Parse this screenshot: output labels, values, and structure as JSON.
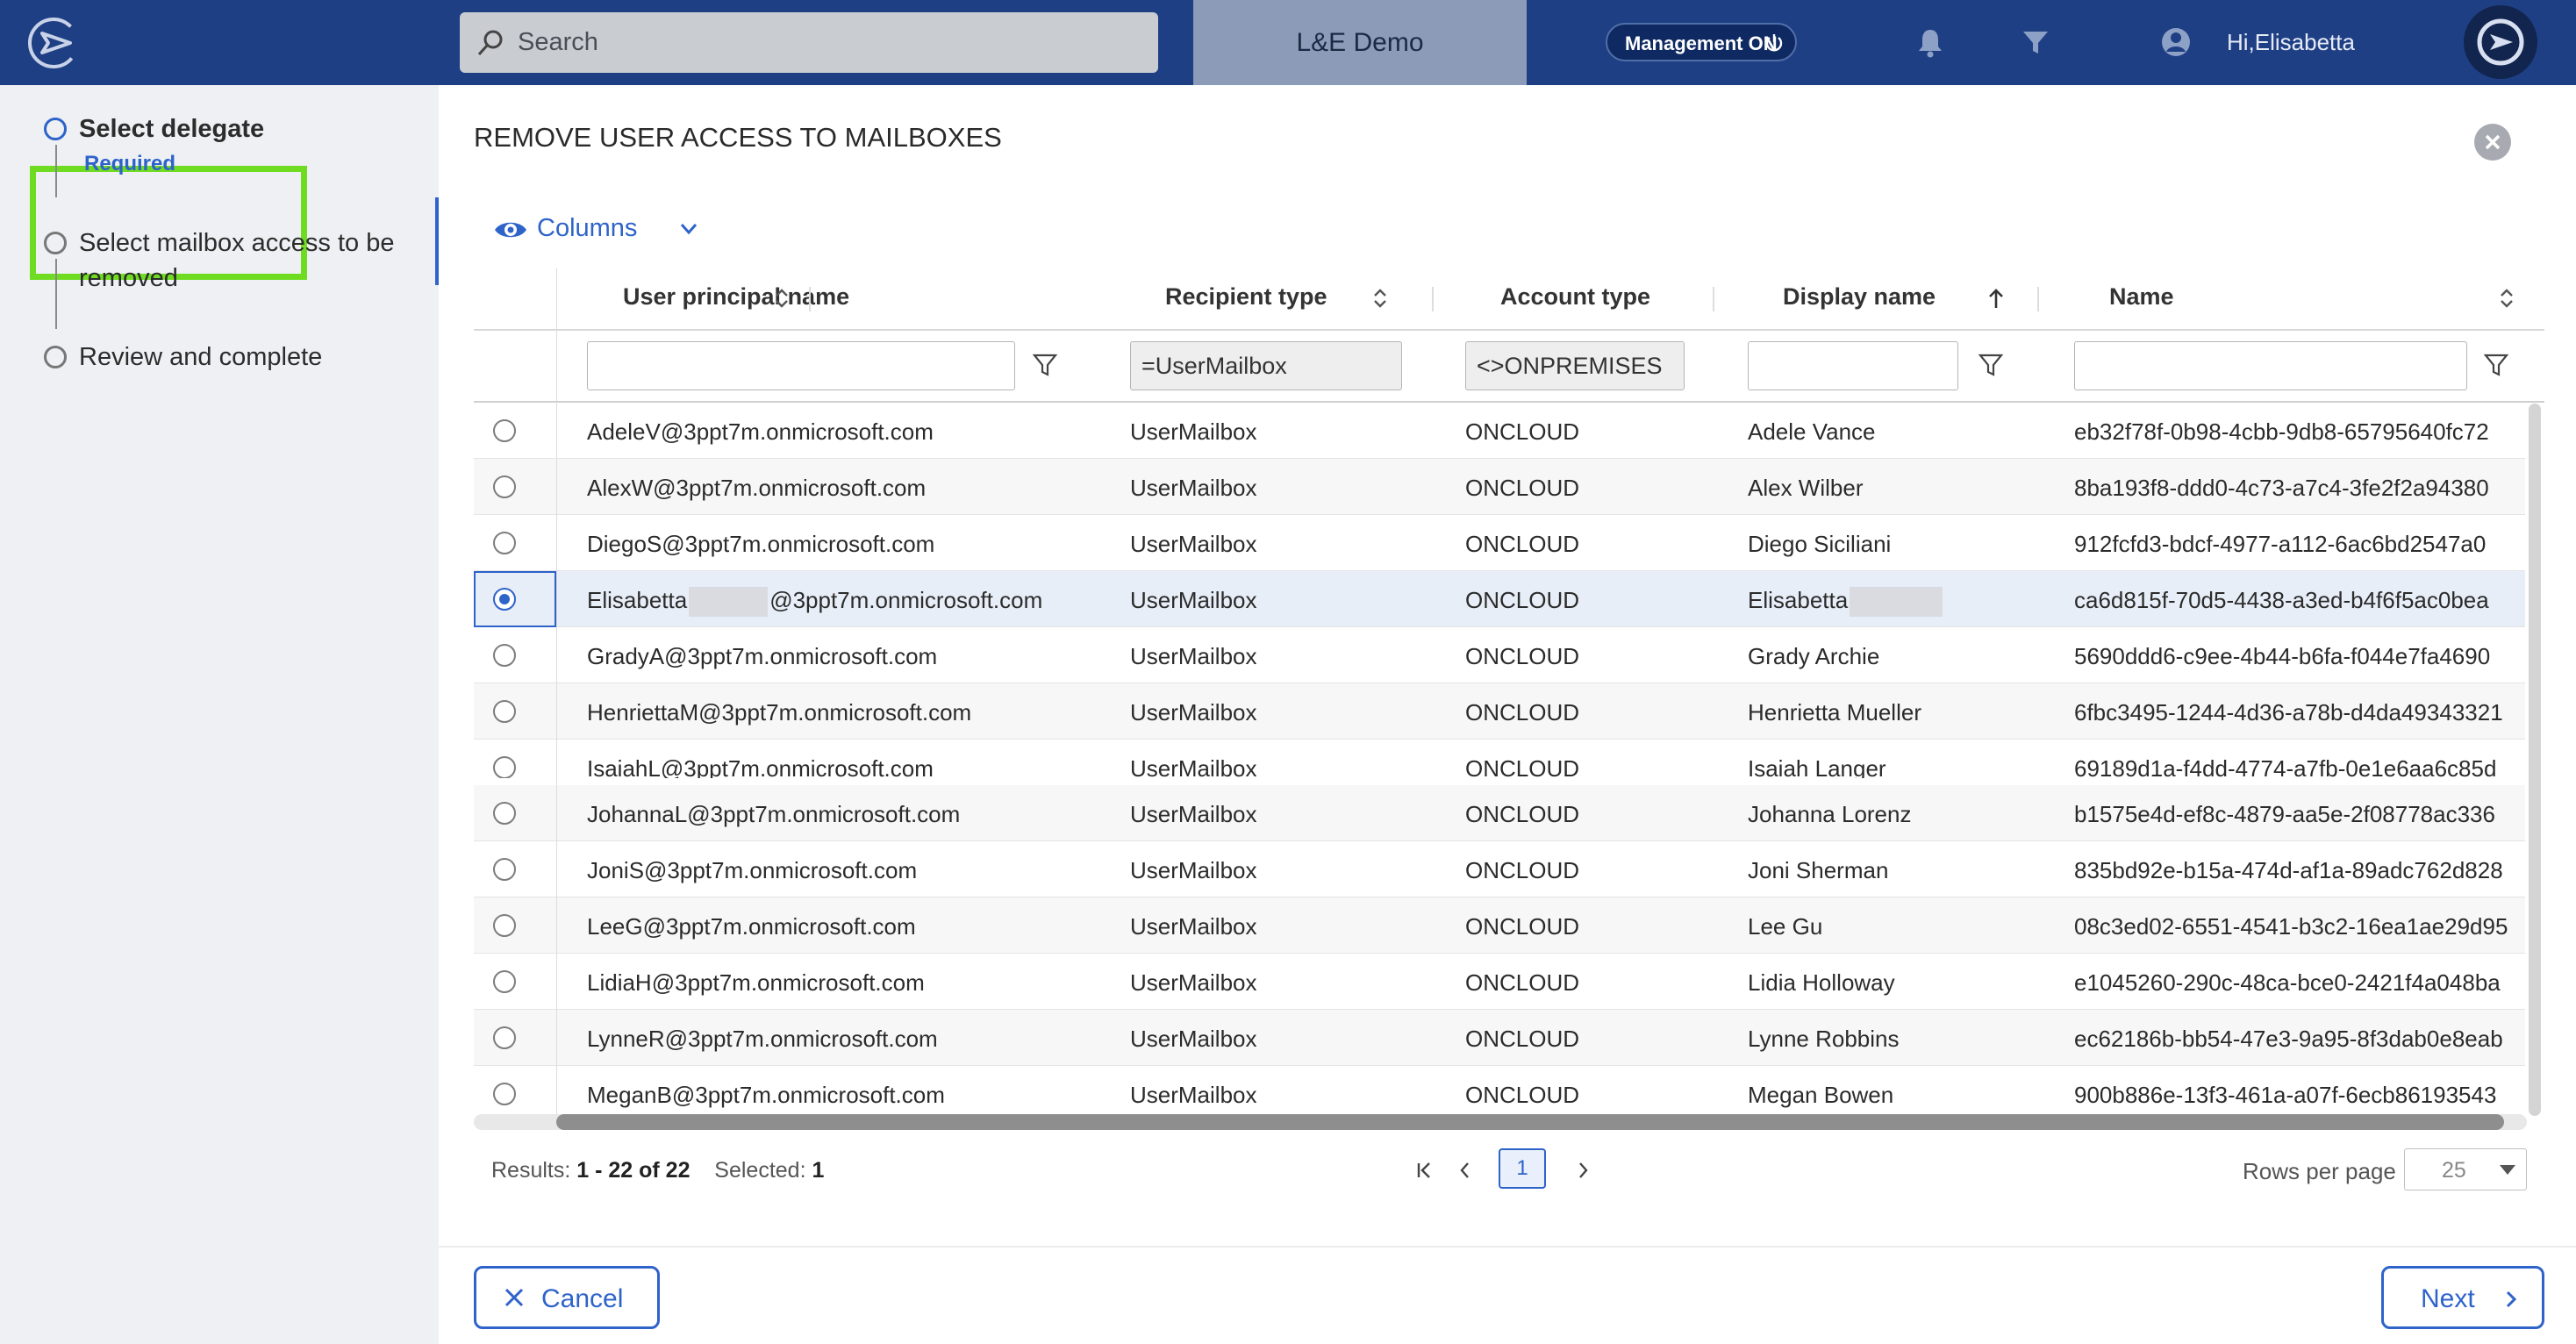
{
  "header": {
    "search_placeholder": "Search",
    "tenant": "L&E Demo",
    "management_label": "Management ON",
    "greeting": "Hi,Elisabetta"
  },
  "steps": [
    {
      "label": "Select delegate",
      "sub": "Required",
      "state": "active"
    },
    {
      "label": "Select mailbox access to be",
      "label2": "removed",
      "state": "pending"
    },
    {
      "label": "Review and complete",
      "state": "pending"
    }
  ],
  "dialog": {
    "title": "REMOVE USER ACCESS TO MAILBOXES",
    "columns_label": "Columns"
  },
  "table": {
    "headers": [
      "User principal name",
      "Recipient type",
      "Account type",
      "Display name",
      "Name"
    ],
    "filters": [
      "",
      "=UserMailbox",
      "<>ONPREMISES",
      "",
      ""
    ],
    "rows": [
      {
        "upn": "AdeleV@3ppt7m.onmicrosoft.com",
        "recipient": "UserMailbox",
        "account": "ONCLOUD",
        "display": "Adele Vance",
        "name": "eb32f78f-0b98-4cbb-9db8-65795640fc72",
        "selected": false
      },
      {
        "upn": "AlexW@3ppt7m.onmicrosoft.com",
        "recipient": "UserMailbox",
        "account": "ONCLOUD",
        "display": "Alex Wilber",
        "name": "8ba193f8-ddd0-4c73-a7c4-3fe2f2a94380",
        "selected": false
      },
      {
        "upn": "DiegoS@3ppt7m.onmicrosoft.com",
        "recipient": "UserMailbox",
        "account": "ONCLOUD",
        "display": "Diego Siciliani",
        "name": "912fcfd3-bdcf-4977-a112-6ac6bd2547a0",
        "selected": false
      },
      {
        "upn_prefix": "Elisabetta",
        "upn_suffix": "@3ppt7m.onmicrosoft.com",
        "recipient": "UserMailbox",
        "account": "ONCLOUD",
        "display": "Elisabetta",
        "name": "ca6d815f-70d5-4438-a3ed-b4f6f5ac0bea",
        "selected": true
      },
      {
        "upn": "GradyA@3ppt7m.onmicrosoft.com",
        "recipient": "UserMailbox",
        "account": "ONCLOUD",
        "display": "Grady Archie",
        "name": "5690ddd6-c9ee-4b44-b6fa-f044e7fa4690",
        "selected": false
      },
      {
        "upn": "HenriettaM@3ppt7m.onmicrosoft.com",
        "recipient": "UserMailbox",
        "account": "ONCLOUD",
        "display": "Henrietta Mueller",
        "name": "6fbc3495-1244-4d36-a78b-d4da49343321",
        "selected": false
      },
      {
        "upn": "IsaiahL@3ppt7m.onmicrosoft.com",
        "recipient": "UserMailbox",
        "account": "ONCLOUD",
        "display": "Isaiah Langer",
        "name": "69189d1a-f4dd-4774-a7fb-0e1e6aa6c85d",
        "selected": false
      },
      {
        "upn": "JohannaL@3ppt7m.onmicrosoft.com",
        "recipient": "UserMailbox",
        "account": "ONCLOUD",
        "display": "Johanna Lorenz",
        "name": "b1575e4d-ef8c-4879-aa5e-2f08778ac336",
        "selected": false
      },
      {
        "upn": "JoniS@3ppt7m.onmicrosoft.com",
        "recipient": "UserMailbox",
        "account": "ONCLOUD",
        "display": "Joni Sherman",
        "name": "835bd92e-b15a-474d-af1a-89adc762d828",
        "selected": false
      },
      {
        "upn": "LeeG@3ppt7m.onmicrosoft.com",
        "recipient": "UserMailbox",
        "account": "ONCLOUD",
        "display": "Lee Gu",
        "name": "08c3ed02-6551-4541-b3c2-16ea1ae29d95",
        "selected": false
      },
      {
        "upn": "LidiaH@3ppt7m.onmicrosoft.com",
        "recipient": "UserMailbox",
        "account": "ONCLOUD",
        "display": "Lidia Holloway",
        "name": "e1045260-290c-48ca-bce0-2421f4a048ba",
        "selected": false
      },
      {
        "upn": "LynneR@3ppt7m.onmicrosoft.com",
        "recipient": "UserMailbox",
        "account": "ONCLOUD",
        "display": "Lynne Robbins",
        "name": "ec62186b-bb54-47e3-9a95-8f3dab0e8eab",
        "selected": false
      },
      {
        "upn": "MeganB@3ppt7m.onmicrosoft.com",
        "recipient": "UserMailbox",
        "account": "ONCLOUD",
        "display": "Megan Bowen",
        "name": "900b886e-13f3-461a-a07f-6ecb86193543",
        "selected": false
      }
    ]
  },
  "footer": {
    "results_label": "Results:",
    "results_range": "1 - 22 of 22",
    "selected_label": "Selected:",
    "selected_count": "1",
    "current_page": "1",
    "rows_per_page_label": "Rows per page",
    "rows_per_page": "25",
    "cancel_label": "Cancel",
    "next_label": "Next"
  },
  "colors": {
    "topbar": "#1f3f85",
    "accent": "#2e63c9",
    "highlight_box": "#6fdc21"
  }
}
